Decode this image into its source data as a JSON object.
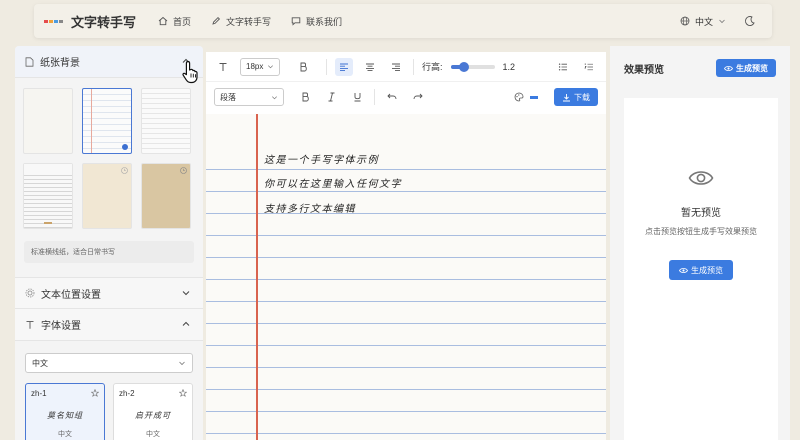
{
  "nav": {
    "brand": "文字转手写",
    "links": [
      "首页",
      "文字转手写",
      "联系我们"
    ],
    "language": "中文"
  },
  "left": {
    "paper_section": "纸张背景",
    "paper_desc": "标准横线纸，适合日常书写",
    "position_section": "文本位置设置",
    "font_section": "字体设置",
    "font_lang": "中文",
    "fonts": [
      {
        "id": "zh-1",
        "sample": "莫名知组",
        "lang": "中文"
      },
      {
        "id": "zh-2",
        "sample": "启开成可",
        "lang": "中文"
      }
    ]
  },
  "toolbar": {
    "font_size": "18px",
    "line_height_label": "行高:",
    "line_height_value": "1.2",
    "line_height_fraction": 0.3,
    "paragraph": "段落",
    "download": "下载"
  },
  "editor": {
    "lines": [
      "这是一个手写字体示例",
      "你可以在这里输入任何文字",
      "支持多行文本编辑"
    ]
  },
  "right": {
    "title": "效果预览",
    "generate": "生成预览",
    "empty_title": "暂无预览",
    "empty_desc": "点击预览按钮生成手写效果预览",
    "generate_center": "生成预览"
  },
  "colors": {
    "accent": "#3b7be0",
    "margin": "#d9634f",
    "rule": "#a9bde0"
  }
}
